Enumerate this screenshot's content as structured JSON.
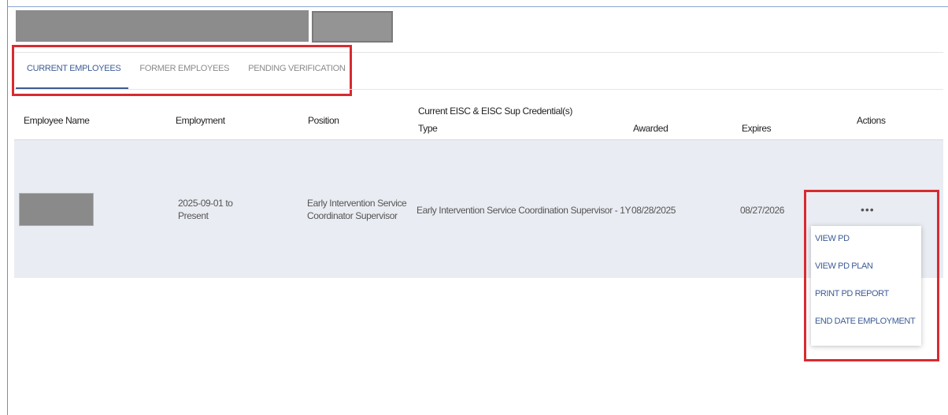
{
  "tabs": [
    {
      "label": "CURRENT EMPLOYEES",
      "active": true
    },
    {
      "label": "FORMER EMPLOYEES",
      "active": false
    },
    {
      "label": "PENDING VERIFICATION",
      "active": false
    }
  ],
  "table": {
    "headers": {
      "employee_name": "Employee Name",
      "employment": "Employment",
      "position": "Position",
      "credential_group": "Current EISC & EISC Sup Credential(s)",
      "type": "Type",
      "awarded": "Awarded",
      "expires": "Expires",
      "actions": "Actions"
    },
    "rows": [
      {
        "employment_line1": "2025-09-01 to",
        "employment_line2": "Present",
        "position_line1": "Early Intervention Service",
        "position_line2": "Coordinator Supervisor",
        "type": "Early Intervention Service Coordination Supervisor - 1Y",
        "awarded": "08/28/2025",
        "expires": "08/27/2026",
        "actions_glyph": "•••"
      }
    ]
  },
  "actions_menu": [
    {
      "label": "VIEW PD"
    },
    {
      "label": "VIEW PD PLAN"
    },
    {
      "label": "PRINT PD REPORT"
    },
    {
      "label": "END DATE EMPLOYMENT"
    }
  ],
  "colors": {
    "accent": "#3d5c95",
    "highlight": "#d72b30",
    "row_background": "#e9ecf2",
    "redaction": "#8c8c8c"
  }
}
